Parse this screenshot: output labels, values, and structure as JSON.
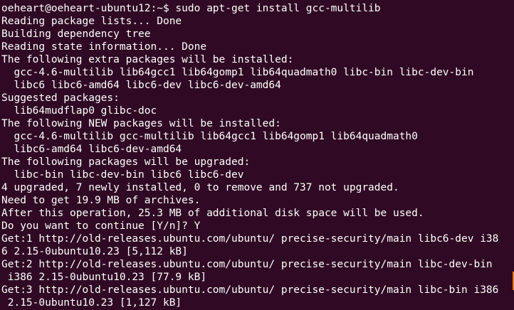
{
  "terminal": {
    "prompt": "oeheart@oeheart-ubuntu12:~$",
    "command": " sudo apt-get install gcc-multilib",
    "lines": [
      "Reading package lists... Done",
      "Building dependency tree",
      "Reading state information... Done",
      "The following extra packages will be installed:",
      "  gcc-4.6-multilib lib64gcc1 lib64gomp1 lib64quadmath0 libc-bin libc-dev-bin",
      "  libc6 libc6-amd64 libc6-dev libc6-dev-amd64",
      "Suggested packages:",
      "  lib64mudflap0 glibc-doc",
      "The following NEW packages will be installed:",
      "  gcc-4.6-multilib gcc-multilib lib64gcc1 lib64gomp1 lib64quadmath0",
      "  libc6-amd64 libc6-dev-amd64",
      "The following packages will be upgraded:",
      "  libc-bin libc-dev-bin libc6 libc6-dev",
      "4 upgraded, 7 newly installed, 0 to remove and 737 not upgraded.",
      "Need to get 19.9 MB of archives.",
      "After this operation, 25.3 MB of additional disk space will be used.",
      "Do you want to continue [Y/n]? Y",
      "Get:1 http://old-releases.ubuntu.com/ubuntu/ precise-security/main libc6-dev i38",
      "6 2.15-0ubuntu10.23 [5,112 kB]",
      "Get:2 http://old-releases.ubuntu.com/ubuntu/ precise-security/main libc-dev-bin",
      " i386 2.15-0ubuntu10.23 [77.9 kB]",
      "Get:3 http://old-releases.ubuntu.com/ubuntu/ precise-security/main libc-bin i386",
      " 2.15-0ubuntu10.23 [1,127 kB]"
    ]
  },
  "colors": {
    "background": "#300a24",
    "text": "#ffffff",
    "scroll_indicator": "#f57900"
  }
}
